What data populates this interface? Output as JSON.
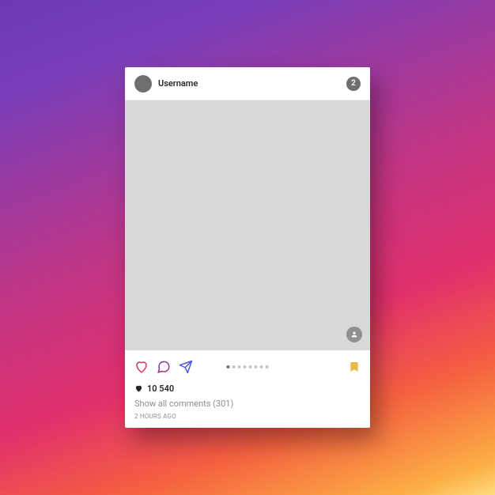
{
  "header": {
    "username": "Username",
    "badge_count": "2"
  },
  "carousel": {
    "dot_count": 8,
    "active_index": 0
  },
  "likes": {
    "count_text": "10 540"
  },
  "comments": {
    "link_text": "Show all comments (301)"
  },
  "timestamp": "2 HOURS AGO"
}
